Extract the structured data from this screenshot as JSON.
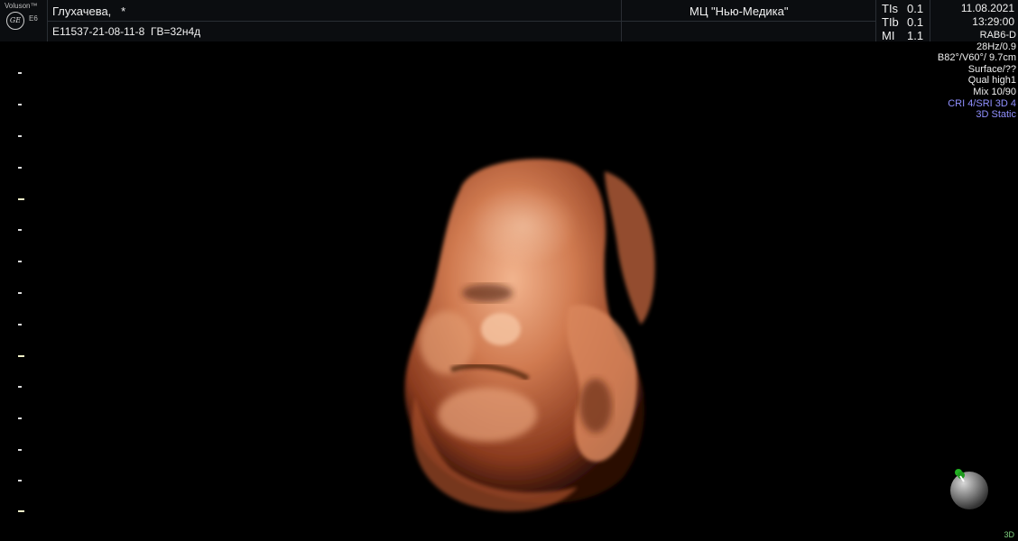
{
  "header": {
    "brand": "Voluson™",
    "logo": "GE",
    "model": "E6",
    "patient_name": "Глухачева,   *",
    "patient_id_line": "E11537-21-08-11-8  ГВ=32н4д",
    "clinic": "МЦ \"Нью-Медика\"",
    "indices": [
      {
        "label": "TIs",
        "value": "0.1"
      },
      {
        "label": "TIb",
        "value": "0.1"
      },
      {
        "label": "MI",
        "value": "1.1"
      }
    ],
    "date": "11.08.2021",
    "time": "13:29:00"
  },
  "params": {
    "probe": "RAB6-D",
    "frame": "28Hz/0.9",
    "sector": "B82°/V60°/ 9.7cm",
    "render": "Surface/??",
    "quality": "Qual high1",
    "mix": "Mix 10/90",
    "cri": "CRI 4/SRI 3D 4",
    "mode_static": "3D Static"
  },
  "mode_tag": "3D",
  "colors": {
    "accent_blue": "#9090ff",
    "skin": "#c8714a",
    "background": "#000000"
  },
  "image": {
    "subject": "3D rendered ultrasound of fetal face",
    "icon": "orientation-ball-icon"
  }
}
